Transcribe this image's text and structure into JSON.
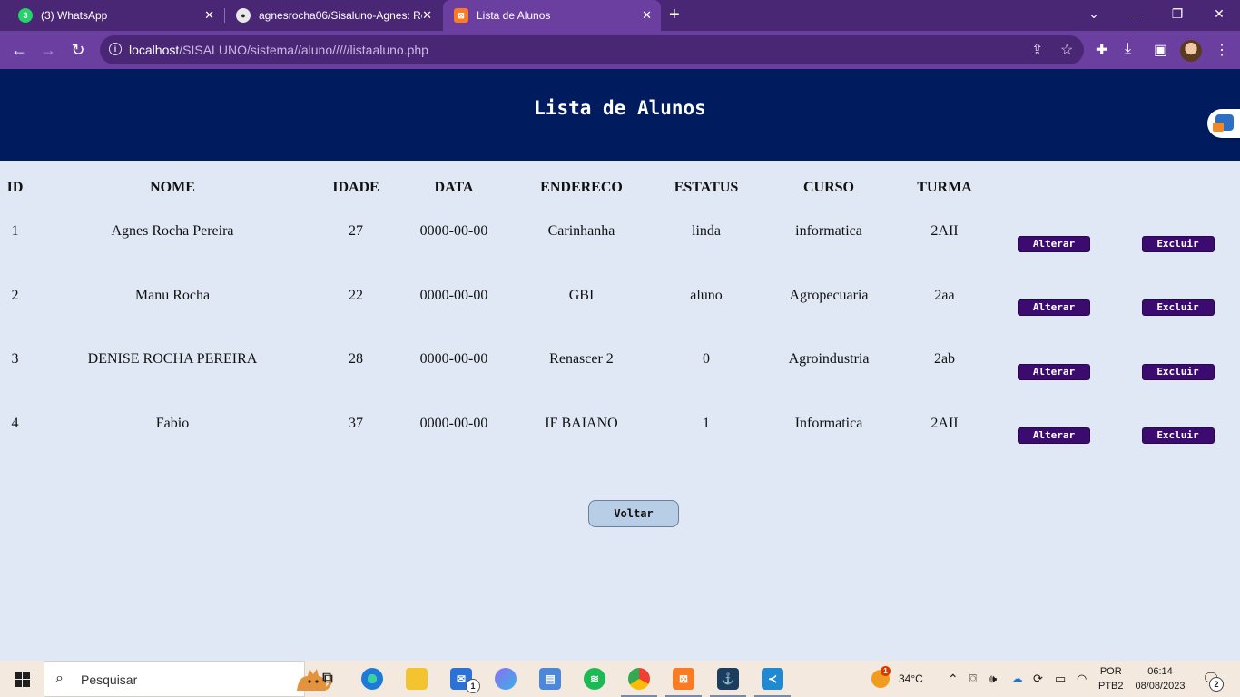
{
  "browser": {
    "tabs": [
      {
        "title": "(3) WhatsApp",
        "favicon_badge": "3",
        "active": false
      },
      {
        "title": "agnesrocha06/Sisaluno-Agnes: Re",
        "active": false
      },
      {
        "title": "Lista de Alunos",
        "active": true
      }
    ],
    "url_host": "localhost",
    "url_path": "/SISALUNO/sistema//aluno/////listaaluno.php"
  },
  "page": {
    "title": "Lista de Alunos",
    "columns": [
      "ID",
      "NOME",
      "IDADE",
      "DATA",
      "ENDERECO",
      "ESTATUS",
      "CURSO",
      "TURMA"
    ],
    "rows": [
      {
        "id": "1",
        "nome": "Agnes Rocha Pereira",
        "idade": "27",
        "data": "0000-00-00",
        "endereco": "Carinhanha",
        "estatus": "linda",
        "curso": "informatica",
        "turma": "2AII"
      },
      {
        "id": "2",
        "nome": "Manu Rocha",
        "idade": "22",
        "data": "0000-00-00",
        "endereco": "GBI",
        "estatus": "aluno",
        "curso": "Agropecuaria",
        "turma": "2aa"
      },
      {
        "id": "3",
        "nome": "DENISE ROCHA PEREIRA",
        "idade": "28",
        "data": "0000-00-00",
        "endereco": "Renascer 2",
        "estatus": "0",
        "curso": "Agroindustria",
        "turma": "2ab"
      },
      {
        "id": "4",
        "nome": "Fabio",
        "idade": "37",
        "data": "0000-00-00",
        "endereco": "IF BAIANO",
        "estatus": "1",
        "curso": "Informatica",
        "turma": "2AII"
      }
    ],
    "alterar_label": "Alterar",
    "excluir_label": "Excluir",
    "voltar_label": "Voltar",
    "colors": {
      "header_bg": "#001c5e",
      "page_bg": "#dfe8f4",
      "action_button_bg": "#3c0b6f",
      "voltar_bg": "#b8cde6"
    }
  },
  "taskbar": {
    "search_placeholder": "Pesquisar",
    "mail_badge": "1",
    "weather_badge": "1",
    "temperature": "34°C",
    "language_top": "POR",
    "language_bottom": "PTB2",
    "time": "06:14",
    "date": "08/08/2023",
    "notification_count": "2"
  }
}
